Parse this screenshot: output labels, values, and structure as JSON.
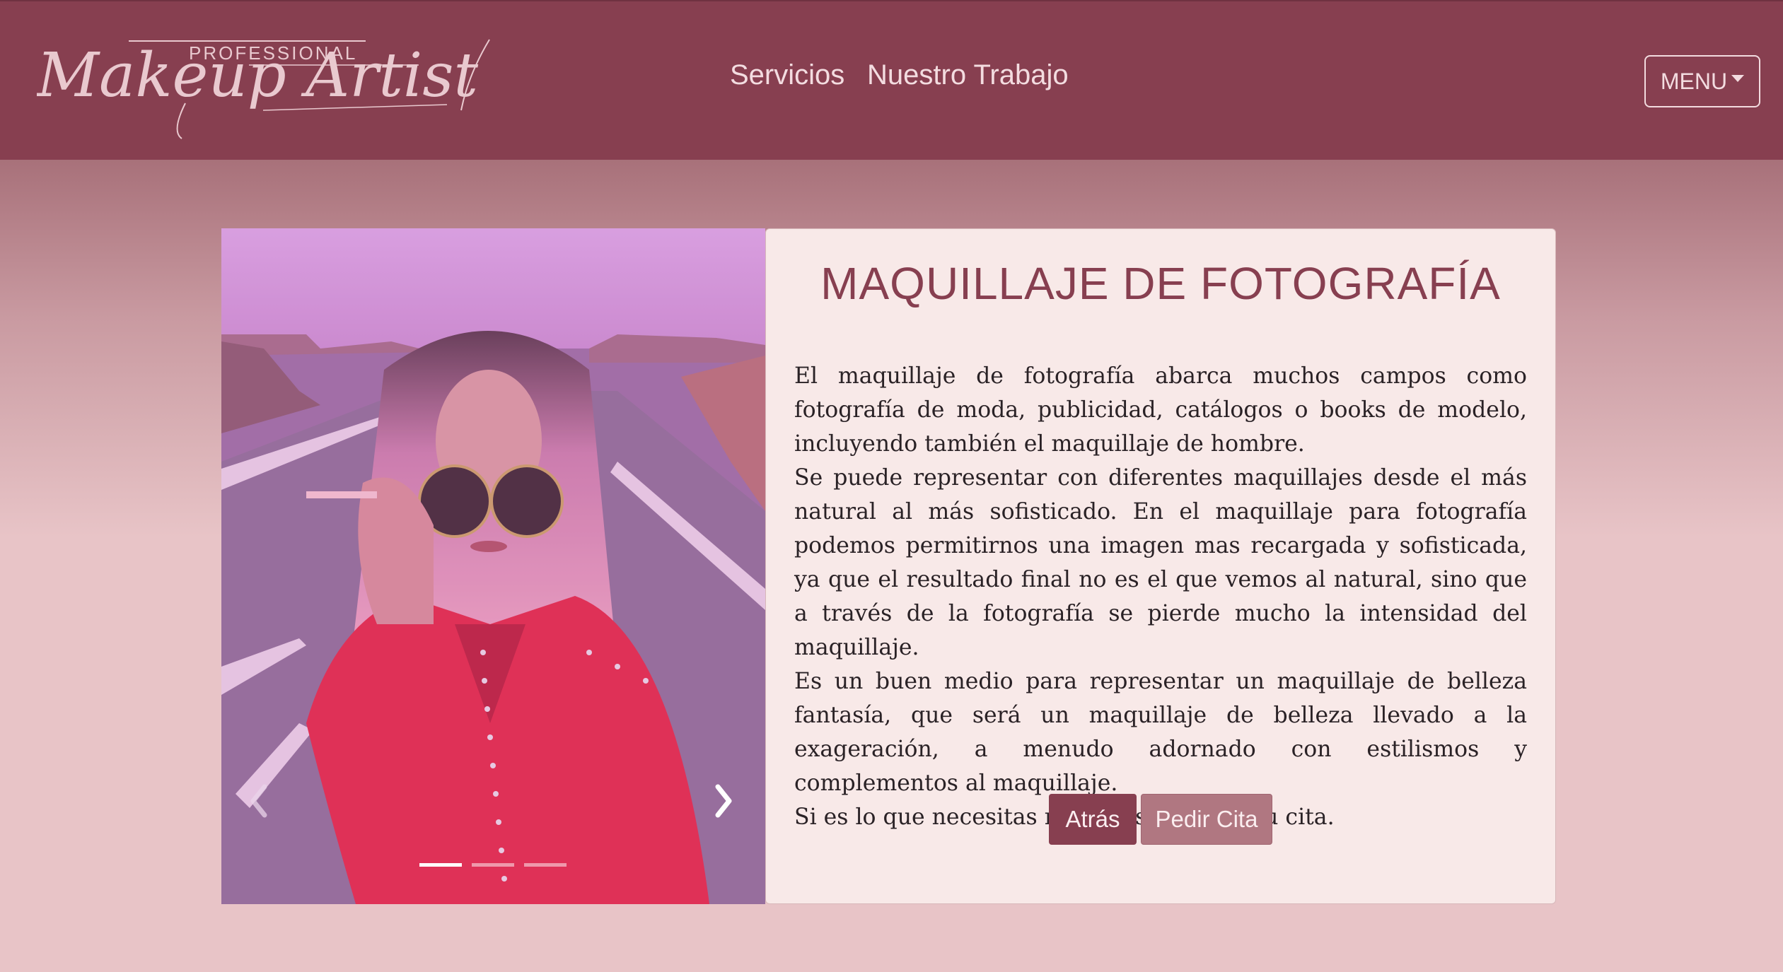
{
  "brand": {
    "logo_top": "PROFESSIONAL",
    "logo_script": "Makeup Artist"
  },
  "nav": {
    "links": [
      "Servicios",
      "Nuestro Trabajo"
    ],
    "menu_label": "MENU"
  },
  "colors": {
    "brand": "#873f50",
    "card_bg": "#f8e9e8",
    "button_secondary": "#b07781"
  },
  "carousel": {
    "prev_icon": "chevron-left-icon",
    "next_icon": "chevron-right-icon",
    "slide_count": 3,
    "active_index": 0
  },
  "card": {
    "title": "MAQUILLAJE DE FOTOGRAFÍA",
    "paragraphs": [
      "El maquillaje de fotografía abarca muchos campos como fotografía de moda, publicidad, catálogos o books de modelo, incluyendo también el maquillaje de hombre.",
      "Se puede representar con diferentes maquillajes desde el más natural al más sofisticado. En el maquillaje para fotografía podemos permitirnos una imagen mas recargada y sofisticada, ya que el resultado final no es el que vemos al natural, sino que a través de la fotografía se pierde mucho la intensidad del maquillaje.",
      "Es un buen medio para representar un maquillaje de belleza fantasía, que será un maquillaje de belleza llevado a la exageración, a menudo adornado con estilismos y complementos al maquillaje.",
      "Si es lo que necesitas no dudes en pedir tu cita."
    ],
    "back_label": "Atrás",
    "appointment_label": "Pedir Cita"
  }
}
